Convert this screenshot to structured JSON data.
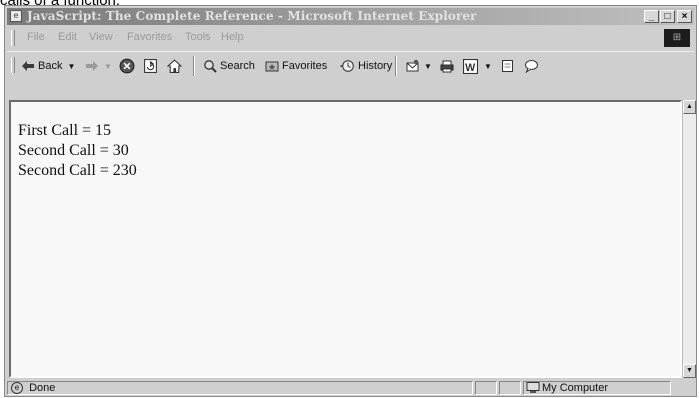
{
  "caption": "calls of a function.",
  "window": {
    "title": "JavaScript: The Complete Reference - Microsoft Internet Explorer",
    "controls": {
      "minimize": "_",
      "maximize": "□",
      "close": "×"
    }
  },
  "menu": {
    "items": [
      "File",
      "Edit",
      "View",
      "Favorites",
      "Tools",
      "Help"
    ]
  },
  "toolbar": {
    "back": "Back",
    "search": "Search",
    "favorites": "Favorites",
    "history": "History"
  },
  "content": {
    "lines": [
      "First Call = 15",
      "Second Call = 30",
      "Second Call = 230"
    ]
  },
  "status": {
    "text": "Done",
    "zone": "My Computer"
  }
}
